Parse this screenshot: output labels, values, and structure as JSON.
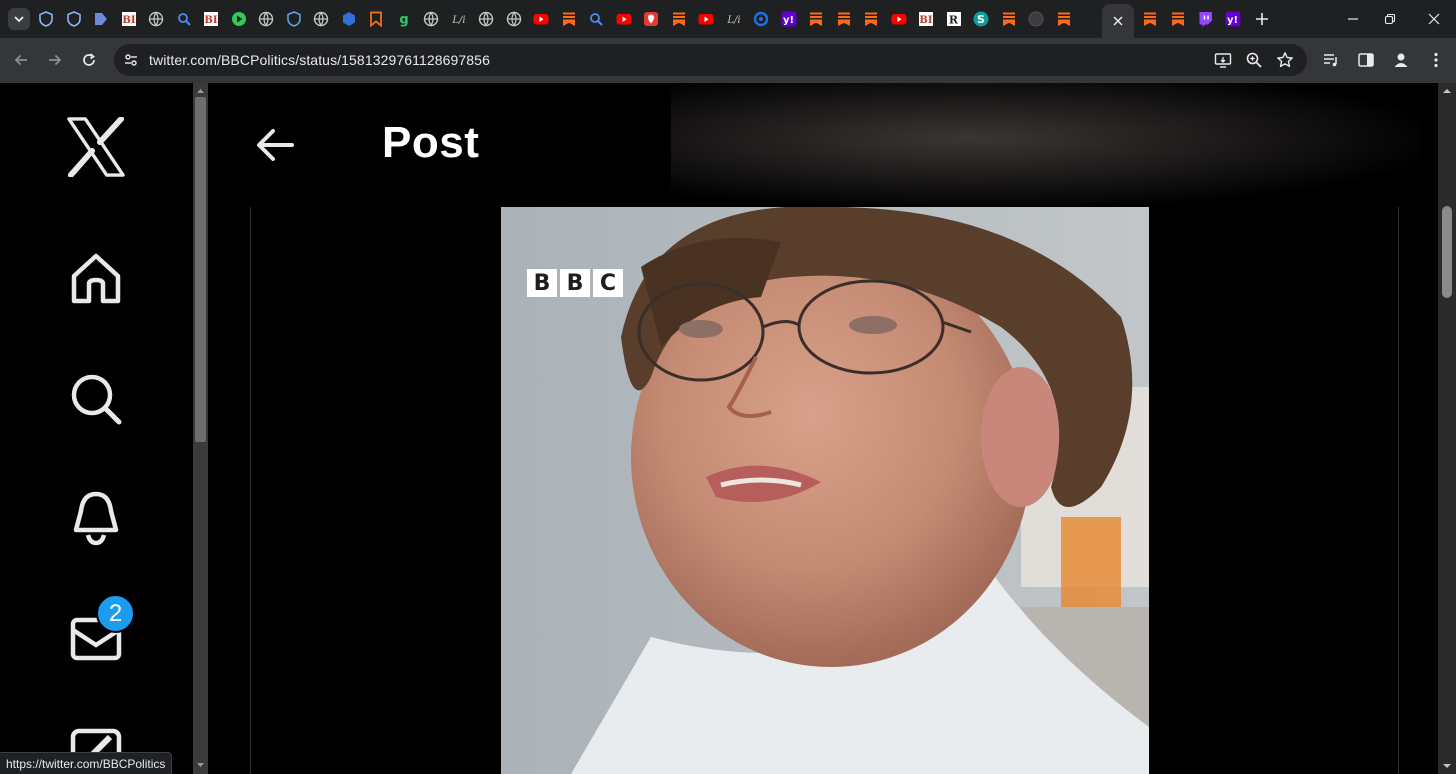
{
  "browser": {
    "tab_icons_left": [
      {
        "icon": "shield-icon",
        "color": "#8ab4f8"
      },
      {
        "icon": "shield-icon",
        "color": "#8ab4f8"
      },
      {
        "icon": "arrow-tag-icon",
        "color": "#6d8bd8"
      },
      {
        "icon": "bi-icon",
        "color": "#c0392b"
      },
      {
        "icon": "globe-icon",
        "color": "#c4c7c5"
      },
      {
        "icon": "search-icon",
        "color": "#4c8bf5"
      },
      {
        "icon": "bi-icon",
        "color": "#c0392b"
      },
      {
        "icon": "play-icon",
        "color": "#34c759"
      },
      {
        "icon": "globe-icon",
        "color": "#c4c7c5"
      },
      {
        "icon": "shield-icon",
        "color": "#5aa0e6"
      },
      {
        "icon": "globe-icon",
        "color": "#c4c7c5"
      },
      {
        "icon": "cube-icon",
        "color": "#2f6fd6"
      },
      {
        "icon": "bookmark-icon",
        "color": "#f2711c"
      },
      {
        "icon": "g-icon",
        "color": "#2ecc71"
      },
      {
        "icon": "globe-icon",
        "color": "#c4c7c5"
      },
      {
        "icon": "slash-icon",
        "color": "#c4c7c5"
      },
      {
        "icon": "globe-icon",
        "color": "#c4c7c5"
      },
      {
        "icon": "globe-icon",
        "color": "#c4c7c5"
      },
      {
        "icon": "youtube-icon",
        "color": "#ff0000"
      },
      {
        "icon": "substack-icon",
        "color": "#ff6719"
      },
      {
        "icon": "search-icon",
        "color": "#4c8bf5"
      },
      {
        "icon": "youtube-icon",
        "color": "#ff0000"
      },
      {
        "icon": "pin-icon",
        "color": "#e53935"
      },
      {
        "icon": "substack-icon",
        "color": "#ff6719"
      },
      {
        "icon": "youtube-icon",
        "color": "#ff0000"
      },
      {
        "icon": "slash-icon",
        "color": "#c4c7c5"
      },
      {
        "icon": "c-icon",
        "color": "#1a73e8"
      },
      {
        "icon": "yahoo-icon",
        "color": "#6001d2"
      },
      {
        "icon": "substack-icon",
        "color": "#ff6719"
      },
      {
        "icon": "substack-icon",
        "color": "#ff6719"
      },
      {
        "icon": "substack-icon",
        "color": "#ff6719"
      },
      {
        "icon": "youtube-icon",
        "color": "#ff0000"
      },
      {
        "icon": "bi-icon",
        "color": "#c0392b"
      },
      {
        "icon": "r-icon",
        "color": "#ffffff"
      },
      {
        "icon": "s-icon",
        "color": "#0f9d9a"
      },
      {
        "icon": "substack-icon",
        "color": "#ff6719"
      },
      {
        "icon": "dark-circle-icon",
        "color": "#3c3d40"
      },
      {
        "icon": "substack-icon",
        "color": "#ff6719"
      }
    ],
    "tab_icons_right": [
      {
        "icon": "substack-icon",
        "color": "#ff6719"
      },
      {
        "icon": "substack-icon",
        "color": "#ff6719"
      },
      {
        "icon": "twitch-icon",
        "color": "#9146ff"
      },
      {
        "icon": "yahoo-icon",
        "color": "#6001d2"
      }
    ],
    "url": "twitter.com/BBCPolitics/status/1581329761128697856",
    "status_url": "https://twitter.com/BBCPolitics"
  },
  "page": {
    "header_title": "Post",
    "messages_badge": "2",
    "media_logo": [
      "B",
      "B",
      "C"
    ]
  },
  "colors": {
    "accent": "#1d9bf0",
    "page_bg": "#000000",
    "toolbar_bg": "#35363a",
    "tabstrip_bg": "#1f2021"
  }
}
